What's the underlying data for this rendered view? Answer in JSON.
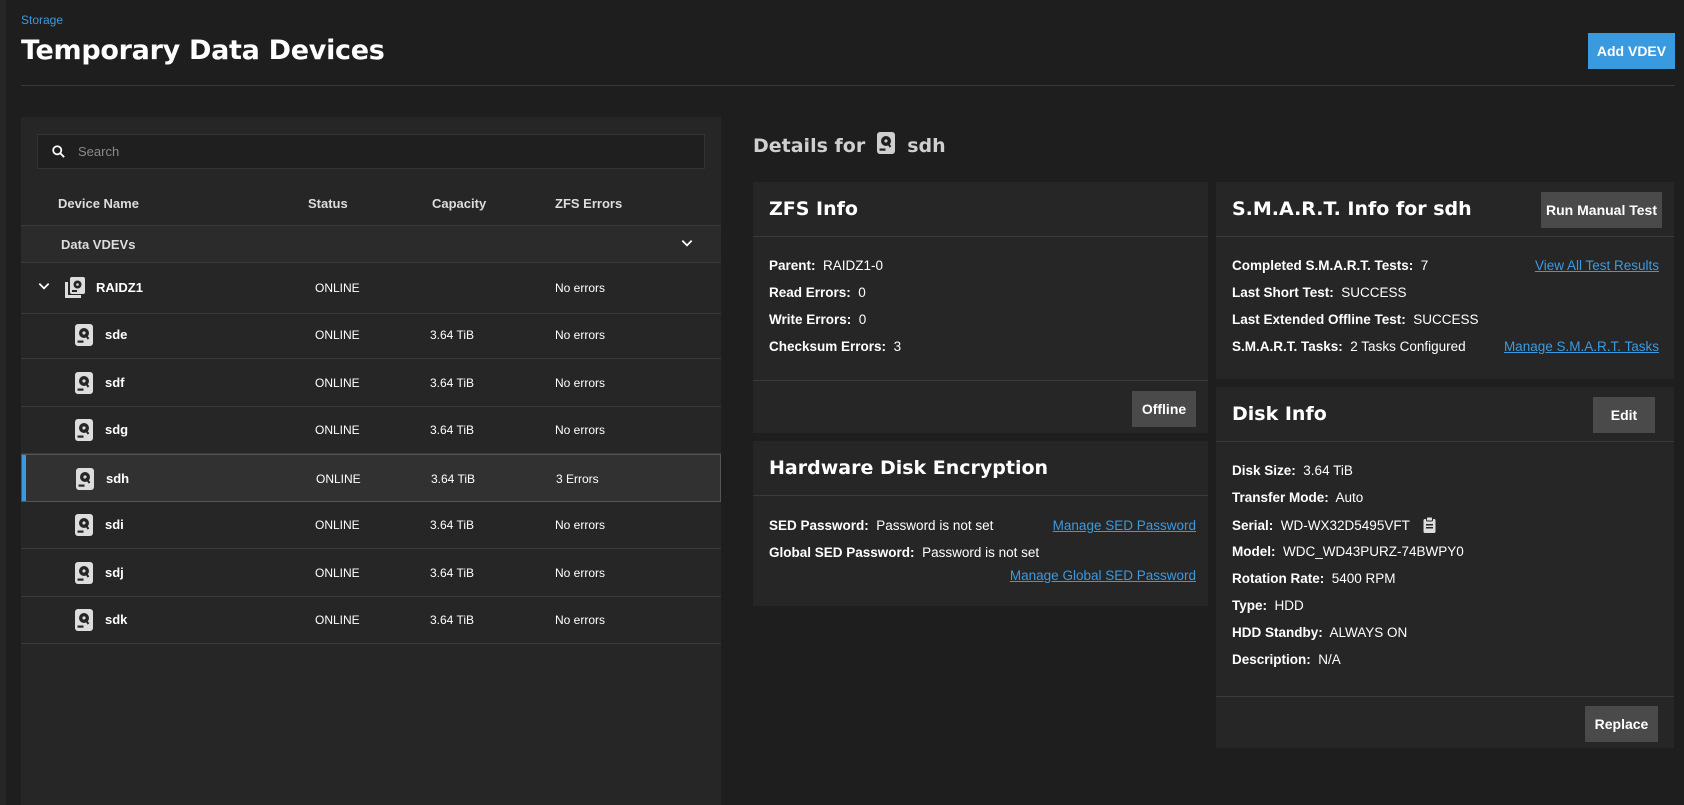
{
  "header": {
    "breadcrumb": "Storage",
    "title": "Temporary Data Devices",
    "add_vdev_label": "Add VDEV"
  },
  "search": {
    "placeholder": "Search"
  },
  "columns": {
    "device_name": "Device Name",
    "status": "Status",
    "capacity": "Capacity",
    "zfs_errors": "ZFS Errors"
  },
  "group": {
    "label": "Data VDEVs"
  },
  "vdev": {
    "name": "RAIDZ1",
    "status": "ONLINE",
    "capacity": "",
    "errors": "No errors"
  },
  "disks": [
    {
      "name": "sde",
      "status": "ONLINE",
      "capacity": "3.64 TiB",
      "errors": "No errors"
    },
    {
      "name": "sdf",
      "status": "ONLINE",
      "capacity": "3.64 TiB",
      "errors": "No errors"
    },
    {
      "name": "sdg",
      "status": "ONLINE",
      "capacity": "3.64 TiB",
      "errors": "No errors"
    },
    {
      "name": "sdh",
      "status": "ONLINE",
      "capacity": "3.64 TiB",
      "errors": "3 Errors"
    },
    {
      "name": "sdi",
      "status": "ONLINE",
      "capacity": "3.64 TiB",
      "errors": "No errors"
    },
    {
      "name": "sdj",
      "status": "ONLINE",
      "capacity": "3.64 TiB",
      "errors": "No errors"
    },
    {
      "name": "sdk",
      "status": "ONLINE",
      "capacity": "3.64 TiB",
      "errors": "No errors"
    }
  ],
  "details": {
    "prefix": "Details for",
    "device": "sdh"
  },
  "zfs_info": {
    "title": "ZFS Info",
    "parent_label": "Parent:",
    "parent": "RAIDZ1-0",
    "read_label": "Read Errors:",
    "read": "0",
    "write_label": "Write Errors:",
    "write": "0",
    "checksum_label": "Checksum Errors:",
    "checksum": "3",
    "offline_label": "Offline"
  },
  "encryption": {
    "title": "Hardware Disk Encryption",
    "sed_label": "SED Password:",
    "sed": "Password is not set",
    "global_label": "Global SED Password:",
    "global": "Password is not set",
    "manage_sed": "Manage SED Password",
    "manage_global": "Manage Global SED Password"
  },
  "smart": {
    "title": "S.M.A.R.T. Info for sdh",
    "run_label": "Run Manual Test",
    "completed_label": "Completed S.M.A.R.T. Tests:",
    "completed": "7",
    "short_label": "Last Short Test:",
    "short": "SUCCESS",
    "extended_label": "Last Extended Offline Test:",
    "extended": "SUCCESS",
    "tasks_label": "S.M.A.R.T. Tasks:",
    "tasks": "2 Tasks Configured",
    "view_all": "View All Test Results",
    "manage_tasks": "Manage S.M.A.R.T. Tasks"
  },
  "disk_info": {
    "title": "Disk Info",
    "edit_label": "Edit",
    "size_label": "Disk Size:",
    "size": "3.64 TiB",
    "transfer_label": "Transfer Mode:",
    "transfer": "Auto",
    "serial_label": "Serial:",
    "serial": "WD-WX32D5495VFT",
    "model_label": "Model:",
    "model": "WDC_WD43PURZ-74BWPY0",
    "rotation_label": "Rotation Rate:",
    "rotation": "5400 RPM",
    "type_label": "Type:",
    "type": "HDD",
    "standby_label": "HDD Standby:",
    "standby": "ALWAYS ON",
    "desc_label": "Description:",
    "desc": "N/A",
    "replace_label": "Replace"
  },
  "colors": {
    "accent": "#3a9ae0",
    "background": "#1e1e1e",
    "card": "#262626"
  }
}
